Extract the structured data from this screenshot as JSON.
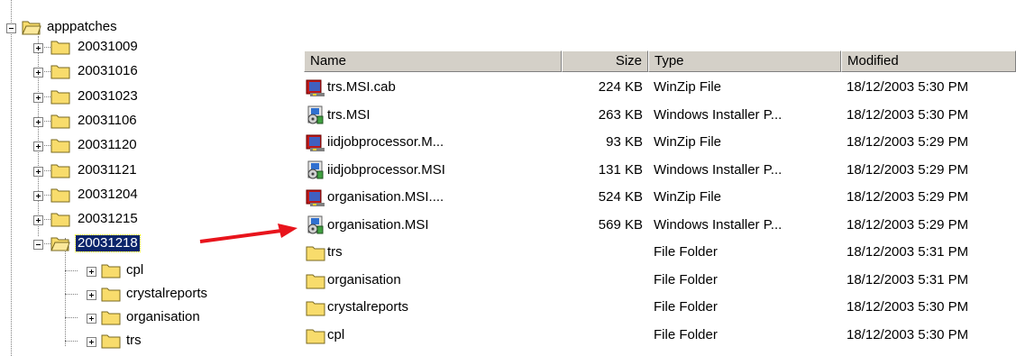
{
  "tree": {
    "root": "apppatches",
    "children": [
      "20031009",
      "20031016",
      "20031023",
      "20031106",
      "20031120",
      "20031121",
      "20031204",
      "20031215",
      "20031218"
    ],
    "selected": "20031218",
    "sub_children": [
      "cpl",
      "crystalreports",
      "organisation",
      "trs"
    ]
  },
  "list": {
    "columns": {
      "name": "Name",
      "size": "Size",
      "type": "Type",
      "modified": "Modified"
    },
    "rows": [
      {
        "name": "trs.MSI.cab",
        "size": "224 KB",
        "type": "WinZip File",
        "modified": "18/12/2003 5:30 PM",
        "icon": "winzip-icon"
      },
      {
        "name": "trs.MSI",
        "size": "263 KB",
        "type": "Windows Installer P...",
        "modified": "18/12/2003 5:30 PM",
        "icon": "installer-icon"
      },
      {
        "name": "iidjobprocessor.M...",
        "size": "93 KB",
        "type": "WinZip File",
        "modified": "18/12/2003 5:29 PM",
        "icon": "winzip-icon"
      },
      {
        "name": "iidjobprocessor.MSI",
        "size": "131 KB",
        "type": "Windows Installer P...",
        "modified": "18/12/2003 5:29 PM",
        "icon": "installer-icon"
      },
      {
        "name": "organisation.MSI....",
        "size": "524 KB",
        "type": "WinZip File",
        "modified": "18/12/2003 5:29 PM",
        "icon": "winzip-icon"
      },
      {
        "name": "organisation.MSI",
        "size": "569 KB",
        "type": "Windows Installer P...",
        "modified": "18/12/2003 5:29 PM",
        "icon": "installer-icon"
      },
      {
        "name": "trs",
        "size": "",
        "type": "File Folder",
        "modified": "18/12/2003 5:31 PM",
        "icon": "folder-icon"
      },
      {
        "name": "organisation",
        "size": "",
        "type": "File Folder",
        "modified": "18/12/2003 5:31 PM",
        "icon": "folder-icon"
      },
      {
        "name": "crystalreports",
        "size": "",
        "type": "File Folder",
        "modified": "18/12/2003 5:30 PM",
        "icon": "folder-icon"
      },
      {
        "name": "cpl",
        "size": "",
        "type": "File Folder",
        "modified": "18/12/2003 5:30 PM",
        "icon": "folder-icon"
      }
    ]
  },
  "colors": {
    "selection": "#0a246a",
    "folder": "#f8dc6c",
    "arrow": "#e8141c",
    "header": "#d4d0c8"
  }
}
